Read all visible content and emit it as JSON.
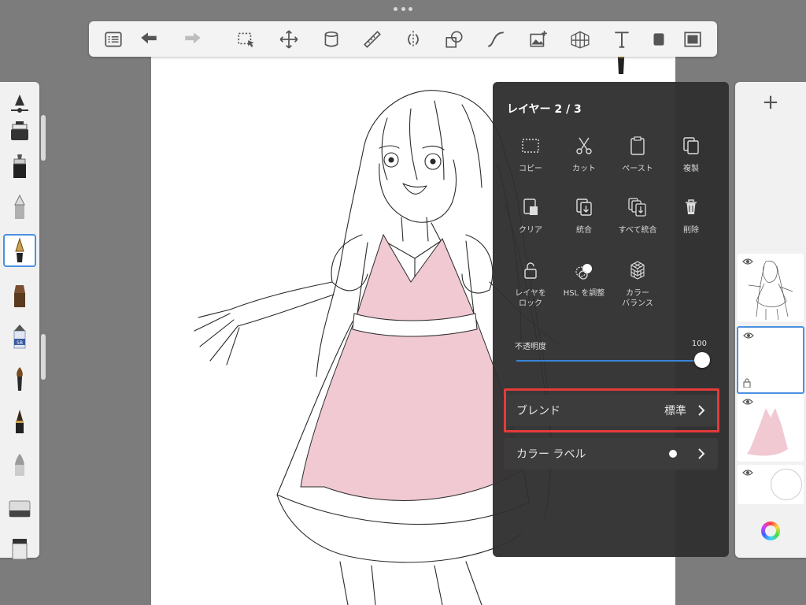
{
  "layer_menu": {
    "title": "レイヤー 2 / 3",
    "actions": [
      {
        "label": "コピー",
        "icon": "copy-dashed-icon"
      },
      {
        "label": "カット",
        "icon": "scissors-icon"
      },
      {
        "label": "ペースト",
        "icon": "paste-icon"
      },
      {
        "label": "複製",
        "icon": "duplicate-icon"
      },
      {
        "label": "クリア",
        "icon": "clear-icon"
      },
      {
        "label": "統合",
        "icon": "merge-icon"
      },
      {
        "label": "すべて統合",
        "icon": "merge-all-icon"
      },
      {
        "label": "削除",
        "icon": "trash-icon"
      },
      {
        "label": "レイヤを\nロック",
        "icon": "lock-icon"
      },
      {
        "label": "HSL を調整",
        "icon": "hsl-icon"
      },
      {
        "label": "カラー\nバランス",
        "icon": "color-balance-icon"
      }
    ],
    "opacity_label": "不透明度",
    "opacity_value": "100",
    "opacity_fraction": 1.0,
    "blend_label": "ブレンド",
    "blend_value": "標準",
    "color_label_label": "カラー ラベル"
  },
  "layers_panel": {
    "add_label": "+",
    "layers": [
      {
        "name": "line-art",
        "selected": false
      },
      {
        "name": "empty",
        "selected": true
      },
      {
        "name": "pink-dress",
        "selected": false
      },
      {
        "name": "background",
        "selected": false
      }
    ]
  },
  "brushes": [
    "ruler",
    "marker",
    "airbrush",
    "pencil",
    "ink-pen",
    "brush-flat",
    "pencil-5B",
    "paintbrush",
    "ink-brush",
    "smudge",
    "eraser",
    "eraser-block"
  ],
  "brush_label_5b": "5B",
  "colors": {
    "accent": "#4a90e2",
    "highlight": "#e53a3a",
    "dress_pink": "#f0c9d2",
    "menu_bg": "#303030"
  }
}
